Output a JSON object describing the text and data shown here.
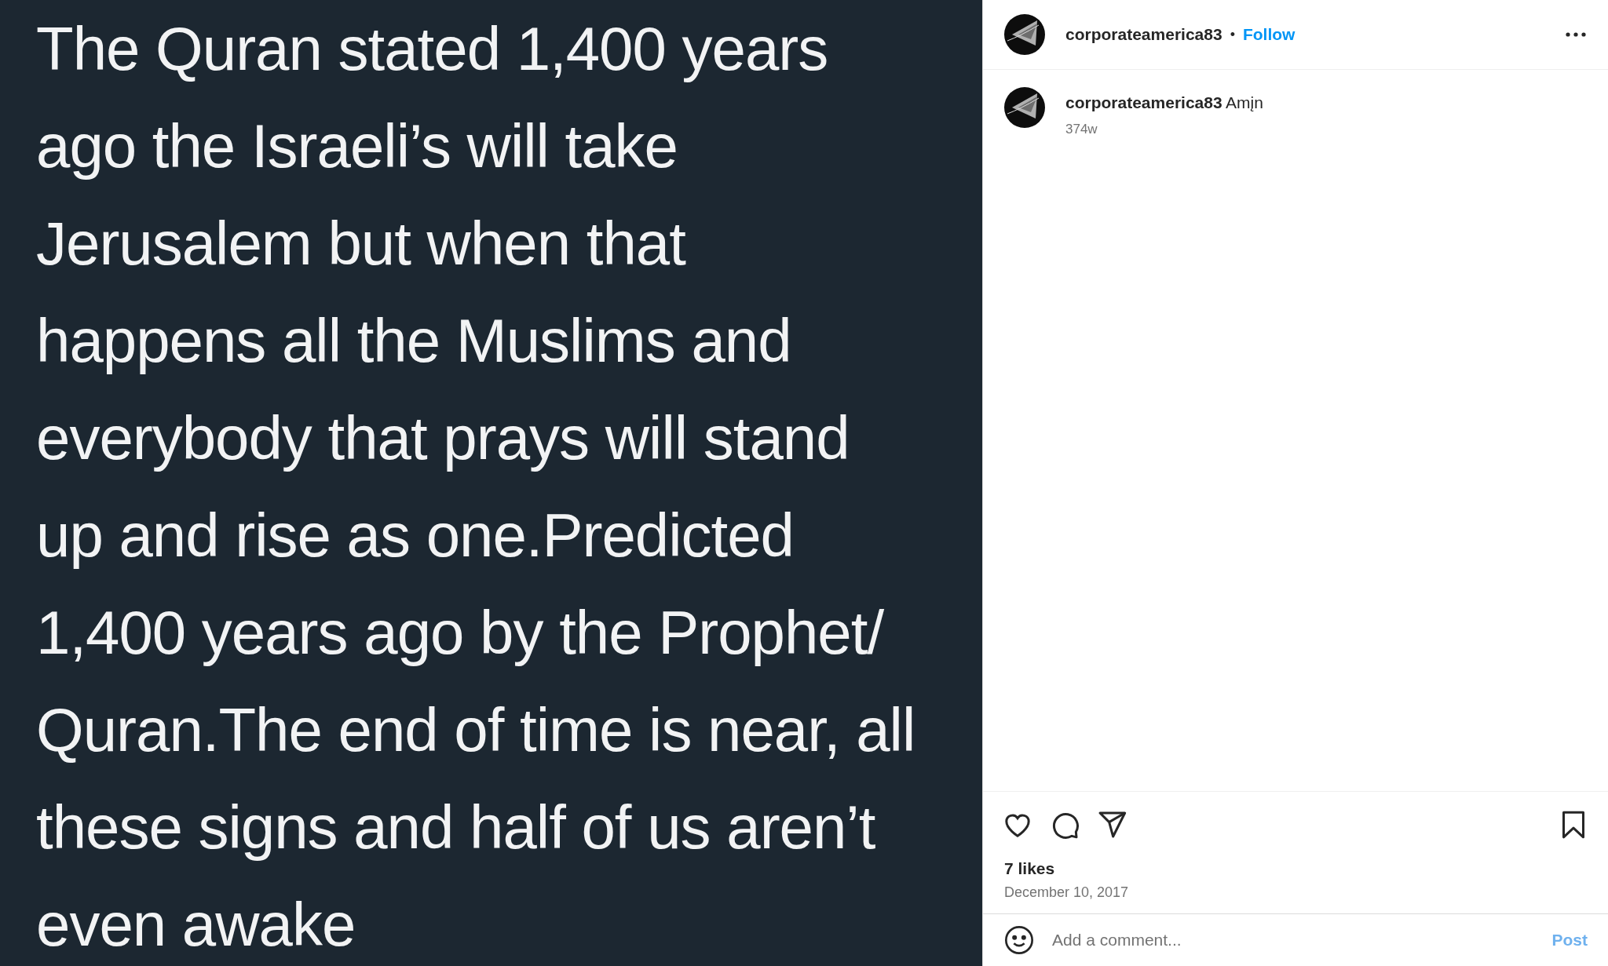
{
  "post_image": {
    "lines": [
      "The Quran stated 1,400 years",
      "ago the Israeli’s will take",
      "Jerusalem but when that",
      "happens all the Muslims and",
      "everybody that prays will stand",
      "up and rise as one.Predicted",
      "1,400 years ago by the Prophet/",
      "Quran.The end of time is near, all",
      "these signs and half of us aren’t",
      "even awake"
    ]
  },
  "header": {
    "username": "corporateamerica83",
    "separator": "•",
    "follow": "Follow"
  },
  "caption": {
    "username": "corporateamerica83",
    "text": "Amįn",
    "age": "374w"
  },
  "likes": "7 likes",
  "date": "December 10, 2017",
  "comment_box": {
    "placeholder": "Add a comment...",
    "post": "Post",
    "post_disabled": true
  }
}
